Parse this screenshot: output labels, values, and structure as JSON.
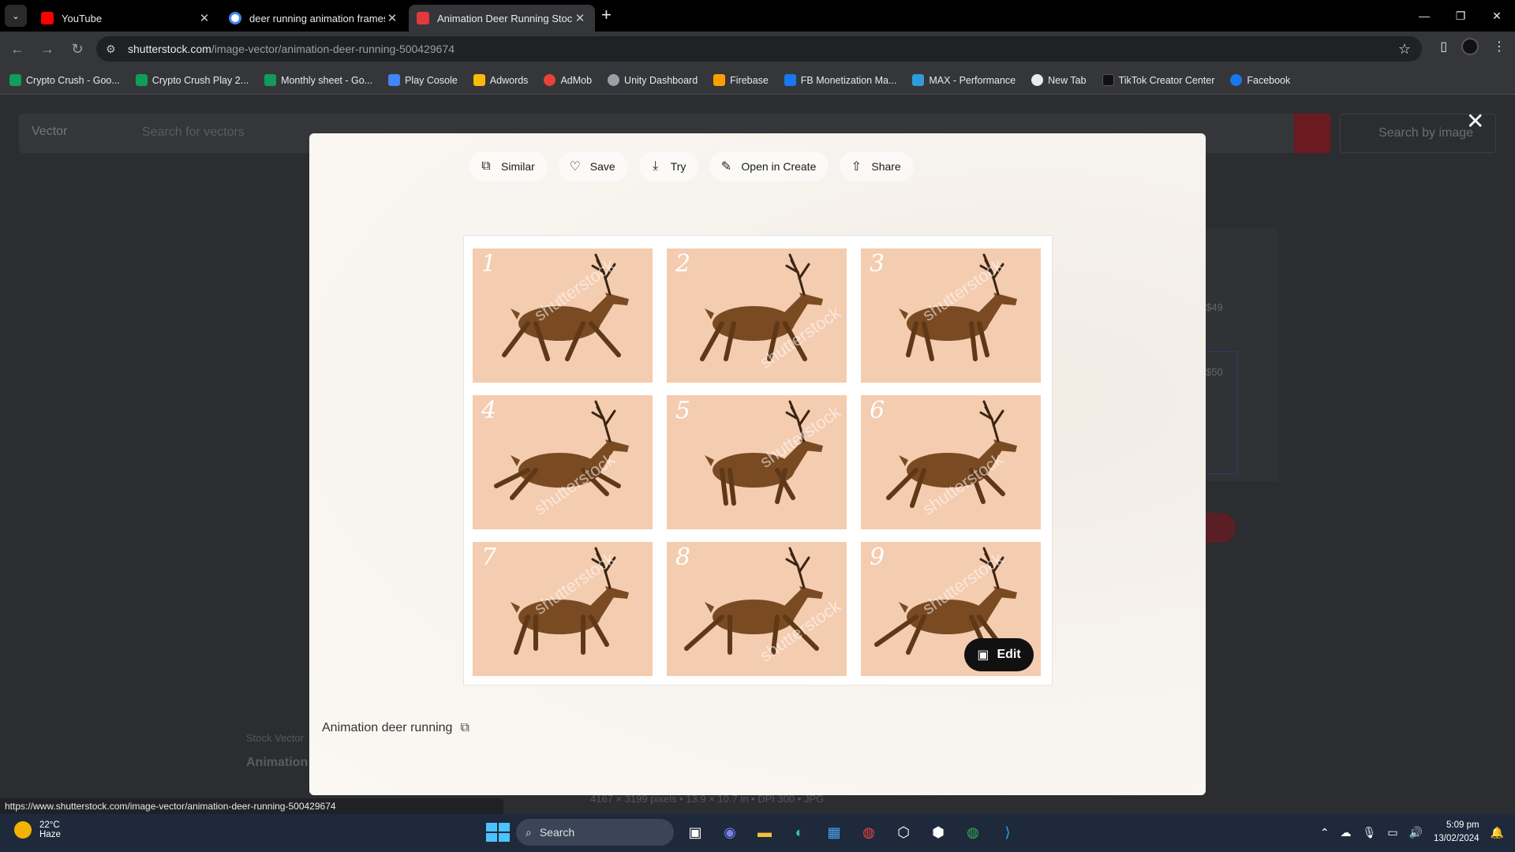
{
  "browser": {
    "tabs": [
      {
        "title": "YouTube",
        "icon": "youtube-icon",
        "color": "#ff0000"
      },
      {
        "title": "deer running animation frames",
        "icon": "google-icon",
        "color": "#4285f4"
      },
      {
        "title": "Animation Deer Running Stock",
        "icon": "shutterstock-icon",
        "color": "#e03a3e"
      }
    ],
    "url_host": "shutterstock.com",
    "url_path": "/image-vector/animation-deer-running-500429674",
    "bookmarks": [
      {
        "label": "Crypto Crush - Goo...",
        "color": "#0f9d58"
      },
      {
        "label": "Crypto Crush Play 2...",
        "color": "#0f9d58"
      },
      {
        "label": "Monthly sheet - Go...",
        "color": "#0f9d58"
      },
      {
        "label": "Play Cosole",
        "color": "#4285f4"
      },
      {
        "label": "Adwords",
        "color": "#fbbc04"
      },
      {
        "label": "AdMob",
        "color": "#ea4335"
      },
      {
        "label": "Unity Dashboard",
        "color": "#9aa0a6"
      },
      {
        "label": "Firebase",
        "color": "#ffa000"
      },
      {
        "label": "FB Monetization Ma...",
        "color": "#1877f2"
      },
      {
        "label": "MAX - Performance",
        "color": "#2d9cdb"
      },
      {
        "label": "New Tab",
        "color": "#e8eaed"
      },
      {
        "label": "TikTok Creator Center",
        "color": "#111111"
      },
      {
        "label": "Facebook",
        "color": "#1877f2"
      }
    ]
  },
  "background_page": {
    "search_type": "Vector",
    "search_placeholder": "Search for vectors",
    "search_by_image": "Search by image",
    "price_1": "$49",
    "price_2": "$50",
    "stock_label": "Stock Vector",
    "title_partial": "Animation",
    "image_meta": "4167 × 3199 pixels • 13.9 × 10.7 in • DPI 300 • JPG"
  },
  "modal": {
    "actions": [
      {
        "label": "Similar",
        "icon": "similar-icon"
      },
      {
        "label": "Save",
        "icon": "heart-icon"
      },
      {
        "label": "Try",
        "icon": "download-icon"
      },
      {
        "label": "Open in Create",
        "icon": "create-icon"
      },
      {
        "label": "Share",
        "icon": "share-icon"
      }
    ],
    "frames": [
      "1",
      "2",
      "3",
      "4",
      "5",
      "6",
      "7",
      "8",
      "9"
    ],
    "watermark": "shutterstock",
    "edit_label": "Edit",
    "caption": "Animation deer running",
    "close_symbol": "✕"
  },
  "status_url": "https://www.shutterstock.com/image-vector/animation-deer-running-500429674",
  "taskbar": {
    "temperature": "22°C",
    "weather": "Haze",
    "search_label": "Search",
    "time": "5:09 pm",
    "date": "13/02/2024"
  }
}
